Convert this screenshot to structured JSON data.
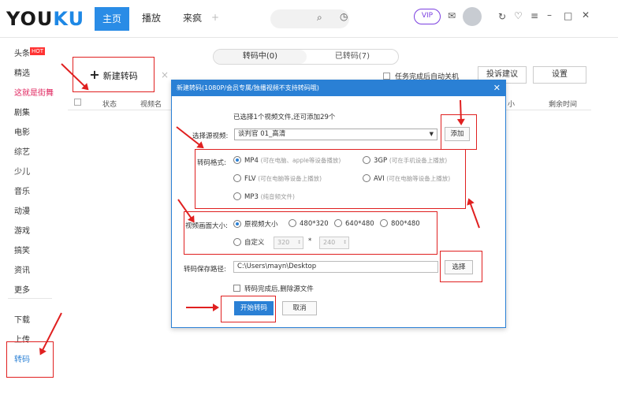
{
  "app": {
    "logo_you": "YOU",
    "logo_ku": "KU"
  },
  "nav": {
    "home": "主页",
    "play": "播放",
    "source": "来疯"
  },
  "sidebar": {
    "items": [
      "头条",
      "精选",
      "这就是街舞",
      "剧集",
      "电影",
      "综艺",
      "少儿",
      "音乐",
      "动漫",
      "游戏",
      "搞笑",
      "资讯",
      "更多"
    ],
    "hot_badge": "HOT",
    "download": "下载",
    "upload": "上传",
    "transcode": "转码"
  },
  "main": {
    "tab_active": "转码中(0)",
    "tab_done": "已转码(7)",
    "new_button": "新建转码",
    "auto_shutdown": "任务完成后自动关机",
    "feedback": "投诉建议",
    "settings": "设置",
    "columns": {
      "status": "状态",
      "name": "视频名",
      "size": "小",
      "remaining": "剩余时间"
    }
  },
  "dialog": {
    "title": "新建转码(1080P/会员专属/独播视频不支持转码哦)",
    "info": "已选择1个视频文件,还可添加29个",
    "source_label": "选择源视频:",
    "source_value": "谈判官 01_高清",
    "add_button": "添加",
    "format_label": "转码格式:",
    "formats": [
      {
        "name": "MP4",
        "hint": "(可在电脑、apple等设备播放)"
      },
      {
        "name": "3GP",
        "hint": "(可在手机设备上播放)"
      },
      {
        "name": "FLV",
        "hint": "(可在电脑等设备上播放)"
      },
      {
        "name": "AVI",
        "hint": "(可在电脑等设备上播放)"
      },
      {
        "name": "MP3",
        "hint": "(纯音频文件)"
      }
    ],
    "size_label": "视频画面大小:",
    "sizes": [
      "原视频大小",
      "480*320",
      "640*480",
      "800*480"
    ],
    "custom_label": "自定义",
    "custom_width": "320",
    "custom_height": "240",
    "times": "*",
    "path_label": "转码保存路径:",
    "path_value": "C:\\Users\\mayn\\Desktop",
    "choose_button": "选择",
    "delete_source": "转码完成后,删除源文件",
    "start_button": "开始转码",
    "cancel_button": "取消"
  }
}
